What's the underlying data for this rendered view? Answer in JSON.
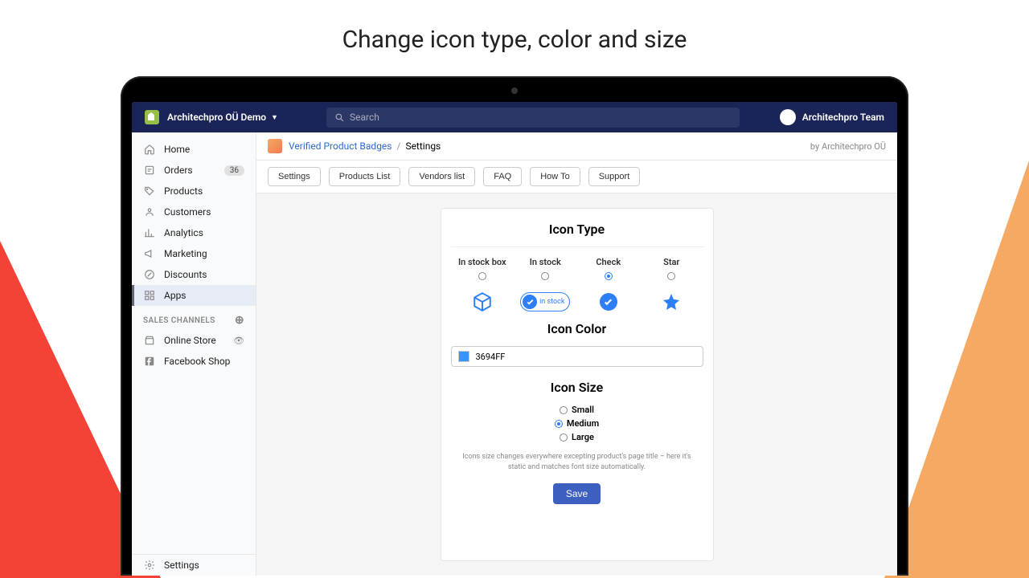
{
  "heading": "Change icon type, color and size",
  "topbar": {
    "store_name": "Architechpro OÜ Demo",
    "search_placeholder": "Search",
    "team_name": "Architechpro Team"
  },
  "sidebar": {
    "items": [
      {
        "label": "Home"
      },
      {
        "label": "Orders",
        "badge": "36"
      },
      {
        "label": "Products"
      },
      {
        "label": "Customers"
      },
      {
        "label": "Analytics"
      },
      {
        "label": "Marketing"
      },
      {
        "label": "Discounts"
      },
      {
        "label": "Apps"
      }
    ],
    "section_label": "SALES CHANNELS",
    "channels": [
      {
        "label": "Online Store"
      },
      {
        "label": "Facebook Shop"
      }
    ],
    "settings_label": "Settings"
  },
  "breadcrumb": {
    "app": "Verified Product Badges",
    "page": "Settings",
    "by": "by Architechpro OÜ"
  },
  "tabs": [
    "Settings",
    "Products List",
    "Vendors list",
    "FAQ",
    "How To",
    "Support"
  ],
  "panel": {
    "icon_type_title": "Icon Type",
    "types": [
      {
        "label": "In stock box",
        "selected": false
      },
      {
        "label": "In stock",
        "selected": false,
        "pill_text": "in stock"
      },
      {
        "label": "Check",
        "selected": true
      },
      {
        "label": "Star",
        "selected": false
      }
    ],
    "icon_color_title": "Icon Color",
    "color_value": "3694FF",
    "icon_size_title": "Icon Size",
    "sizes": [
      {
        "label": "Small",
        "selected": false
      },
      {
        "label": "Medium",
        "selected": true
      },
      {
        "label": "Large",
        "selected": false
      }
    ],
    "note": "Icons size changes everywhere excepting product's page title – here it's static and matches font size automatically.",
    "save_label": "Save"
  }
}
